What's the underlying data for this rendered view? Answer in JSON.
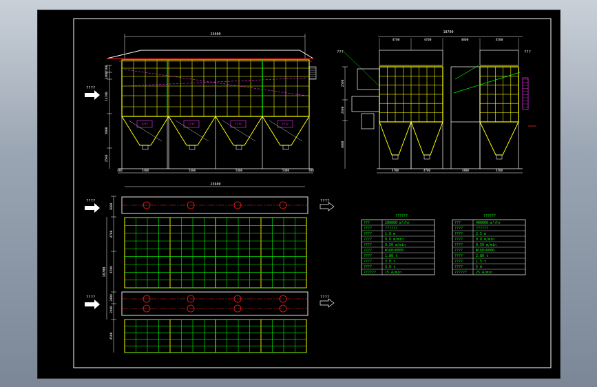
{
  "colors": {
    "yellow": "#ffff00",
    "green": "#00ff00",
    "white": "#ffffff",
    "red": "#ff2020",
    "magenta": "#ff33ff",
    "cyan": "#00ffff",
    "frame": "#ffffff",
    "sheet": "#000000"
  },
  "front_view": {
    "overall_dim": "23600",
    "inlet_label": "????",
    "left_dims": [
      "2500",
      "1400",
      "14700",
      "5000",
      "2500"
    ],
    "bottom_dims": [
      "400",
      "5400",
      "5400",
      "5400",
      "5400",
      "400"
    ],
    "hopper_tags": [
      "????",
      "????",
      "????",
      "????"
    ]
  },
  "side_view": {
    "overall_dim": "18700",
    "top_dims": [
      "4700",
      "4700",
      "4800",
      "4500"
    ],
    "bottom_dims": [
      "4700",
      "4700",
      "4800",
      "4500"
    ],
    "left_dims": [
      "2500",
      "2600",
      "3000"
    ],
    "callout_left": "???",
    "callout_right": "???"
  },
  "plan_view": {
    "overall_dim": "23600",
    "left_dims": [
      "2000",
      "4700",
      "4700",
      "2400",
      "2400",
      "4500"
    ],
    "outer_dim": "18700",
    "inlet_top": "????",
    "outlet_top": "????",
    "inlet_bottom": "????",
    "outlet_bottom": "????"
  },
  "table_left": {
    "title": "??????",
    "rows": [
      [
        "???",
        "200000 m³/hr"
      ],
      [
        "????",
        "??????"
      ],
      [
        "????",
        "1.0 m"
      ],
      [
        "????",
        "0.8 m/min"
      ],
      [
        "????",
        "0.50 m/min"
      ],
      [
        "????",
        "Φ160×6000"
      ],
      [
        "????",
        "1.80 t"
      ],
      [
        "????",
        "3.0 t"
      ],
      [
        "????",
        "3.0 t"
      ],
      [
        "??????",
        "15 A/min"
      ]
    ]
  },
  "table_right": {
    "title": "??????",
    "rows": [
      [
        "???",
        "400000 m³/hr"
      ],
      [
        "????",
        "??????"
      ],
      [
        "????",
        "2.5 m"
      ],
      [
        "????",
        "0.8 m/min"
      ],
      [
        "????",
        "0.50 m/min"
      ],
      [
        "????",
        "Φ160×6000"
      ],
      [
        "????",
        "2.80 t"
      ],
      [
        "????",
        "1.5 t"
      ],
      [
        "????",
        "5 A"
      ],
      [
        "??????",
        "25 A/min"
      ]
    ]
  }
}
